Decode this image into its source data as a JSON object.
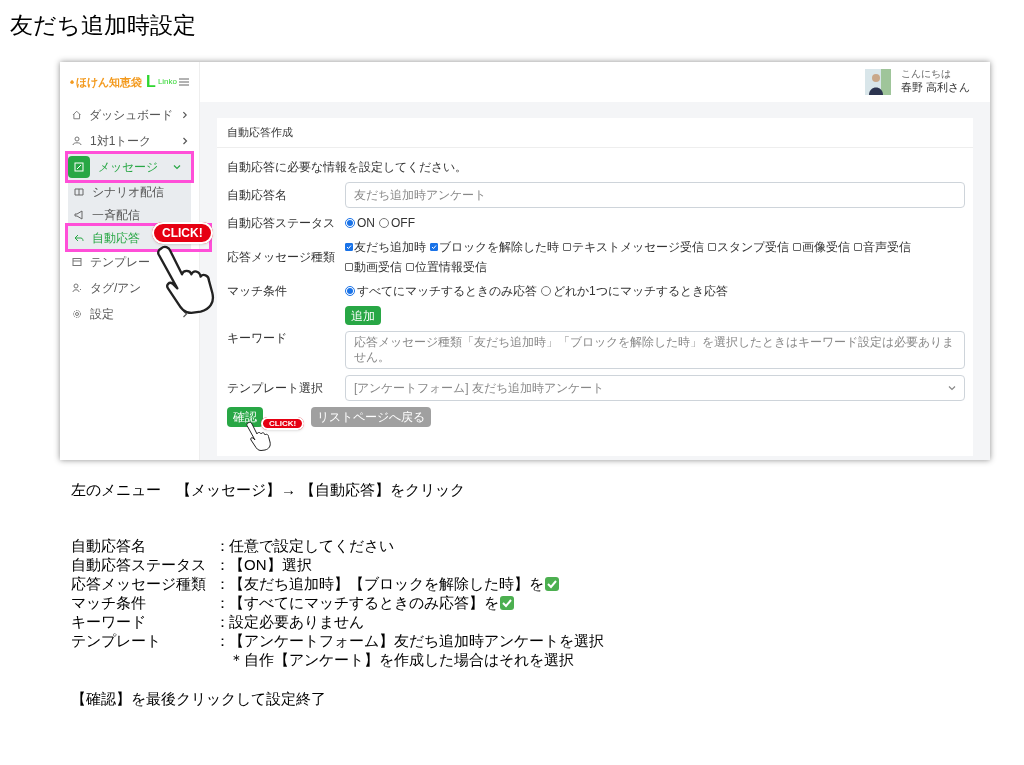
{
  "slide_title": "友だち追加時設定",
  "app": {
    "logo": {
      "text": "ほけん知恵袋",
      "letter": "L",
      "sub": "Linko"
    },
    "sidebar": [
      {
        "label": "ダッシュボード",
        "arrow": true,
        "expanded": false,
        "selected": false,
        "highlighted": false
      },
      {
        "label": "1対1トーク",
        "arrow": true,
        "expanded": false,
        "selected": false,
        "highlighted": false
      },
      {
        "label": "メッセージ",
        "arrow": true,
        "expanded": true,
        "selected": true,
        "highlighted": true,
        "children": [
          {
            "label": "シナリオ配信",
            "selected": false,
            "highlighted": false
          },
          {
            "label": "一斉配信",
            "selected": false,
            "highlighted": false
          },
          {
            "label": "自動応答",
            "selected": true,
            "highlighted": true
          }
        ]
      },
      {
        "label": "テンプレー",
        "selected": false,
        "highlighted": false
      },
      {
        "label": "タグ/アン",
        "selected": false,
        "highlighted": false
      },
      {
        "label": "設定",
        "arrow": true,
        "expanded": false,
        "selected": false,
        "highlighted": false
      }
    ],
    "user": {
      "greeting": "こんにちは",
      "name": "春野 高利さん"
    },
    "card_title": "自動応答作成",
    "description": "自動応答に必要な情報を設定してください。",
    "form": [
      {
        "kind": "text",
        "label": "自動応答名",
        "placeholder": "友だち追加時アンケート"
      },
      {
        "kind": "radio",
        "label": "自動応答ステータス",
        "options": [
          {
            "label": "ON",
            "selected": true
          },
          {
            "label": "OFF",
            "selected": false
          }
        ]
      },
      {
        "kind": "checkbox",
        "label": "応答メッセージ種類",
        "options": [
          {
            "label": "友だち追加時",
            "checked": true
          },
          {
            "label": "ブロックを解除した時",
            "checked": true
          },
          {
            "label": "テキストメッセージ受信",
            "checked": false
          },
          {
            "label": "スタンプ受信",
            "checked": false
          },
          {
            "label": "画像受信",
            "checked": false
          },
          {
            "label": "音声受信",
            "checked": false
          },
          {
            "label": "動画受信",
            "checked": false
          },
          {
            "label": "位置情報受信",
            "checked": false
          }
        ]
      },
      {
        "kind": "radio",
        "label": "マッチ条件",
        "options": [
          {
            "label": "すべてにマッチするときのみ応答",
            "selected": true
          },
          {
            "label": "どれか1つにマッチするとき応答",
            "selected": false
          }
        ]
      },
      {
        "kind": "keyword",
        "label": "キーワード",
        "button": "追加",
        "placeholder": "応答メッセージ種類「友だち追加時」「ブロックを解除した時」を選択したときはキーワード設定は必要ありません。"
      },
      {
        "kind": "select",
        "label": "テンプレート選択",
        "value": "[アンケートフォーム] 友だち追加時アンケート"
      }
    ],
    "buttons": [
      {
        "kind": "primary",
        "label": "確認"
      },
      {
        "kind": "secondary",
        "label": "リストページへ戻る"
      }
    ],
    "callouts": [
      "CLICK!",
      "CLICK!"
    ]
  },
  "instruction": "左のメニュー　【メッセージ】→ 【自動応答】をクリック",
  "settings": [
    {
      "label": "自動応答名",
      "sep": "：",
      "value": "任意で設定してください",
      "checkmark": false
    },
    {
      "label": "自動応答ステータス",
      "sep": "：",
      "value": "【ON】選択",
      "checkmark": false
    },
    {
      "label": "応答メッセージ種類",
      "sep": "：",
      "value": "【友だち追加時】【ブロックを解除した時】を",
      "checkmark": true
    },
    {
      "label": "マッチ条件",
      "sep": "：",
      "value": "【すべてにマッチするときのみ応答】を",
      "checkmark": true
    },
    {
      "label": "キーワード",
      "sep": "：",
      "value": "設定必要ありません",
      "checkmark": false
    },
    {
      "label": "テンプレート",
      "sep": "：",
      "value": "【アンケートフォーム】友だち追加時アンケートを選択",
      "note": "＊自作【アンケート】を作成した場合はそれを選択",
      "checkmark": false
    }
  ],
  "closing": "【確認】を最後クリックして設定終了"
}
